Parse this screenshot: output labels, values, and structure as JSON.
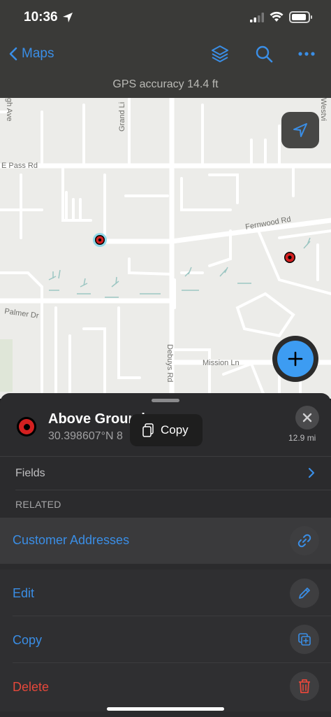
{
  "status_bar": {
    "time": "10:36"
  },
  "nav": {
    "back_label": "Maps"
  },
  "gps": {
    "accuracy_text": "GPS accuracy 14.4 ft"
  },
  "map": {
    "road_labels": {
      "pass_rd": "E Pass Rd",
      "fernwood": "Fernwood Rd",
      "palmer": "Palmer Dr",
      "debuys": "Debuys Rd",
      "mission": "Mission Ln",
      "grand": "Grand Li",
      "westvi": "Westvi",
      "ave": "gh Ave"
    }
  },
  "sheet": {
    "title": "Above Ground",
    "subtitle": "30.398607°N  8",
    "copy_tooltip": "Copy",
    "distance": "12.9 mi",
    "fields_label": "Fields",
    "related_label": "RELATED",
    "related_items": [
      {
        "label": "Customer Addresses"
      }
    ],
    "actions": [
      {
        "label": "Edit",
        "color": "#3a8ee6"
      },
      {
        "label": "Copy",
        "color": "#3a8ee6"
      },
      {
        "label": "Delete",
        "color": "#e5483b"
      }
    ]
  },
  "colors": {
    "accent": "#3a8ee6",
    "destructive": "#e5483b",
    "marker": "#d42020"
  }
}
